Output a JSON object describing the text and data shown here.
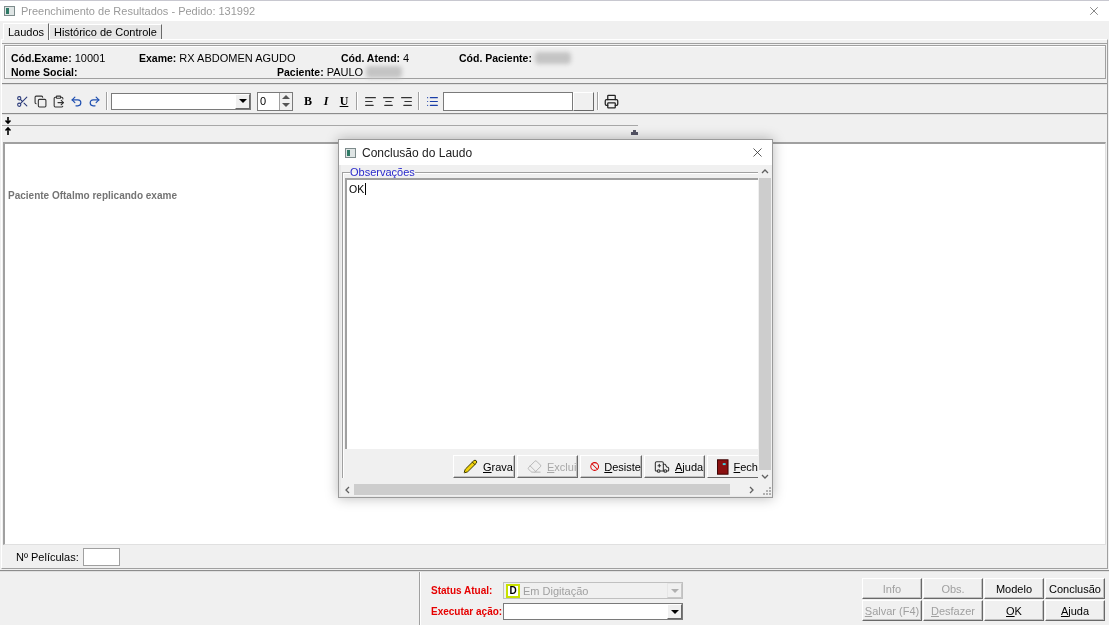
{
  "window": {
    "title": "Preenchimento de Resultados - Pedido: 131992"
  },
  "tabs": [
    {
      "label": "Laudos",
      "selected": true
    },
    {
      "label": "Histórico de Controle",
      "selected": false
    }
  ],
  "header": {
    "rows": [
      [
        {
          "label": "Cód.Exame:",
          "value": "10001"
        },
        {
          "label": "Exame:",
          "value": "RX ABDOMEN AGUDO"
        },
        {
          "label": "Cód. Atend:",
          "value": "4"
        },
        {
          "label": "Cód. Paciente:",
          "redacted": true
        }
      ],
      [
        {
          "label": "Nome Social:"
        },
        {
          "label": "Paciente:",
          "value": "PAULO",
          "redacted": true
        }
      ]
    ]
  },
  "toolbar": {
    "font_size": "0",
    "format_buttons": [
      {
        "kind": "bold",
        "label": "B"
      },
      {
        "kind": "italic",
        "label": "I"
      },
      {
        "kind": "underline",
        "label": "U"
      }
    ]
  },
  "editor": {
    "text": "Paciente Oftalmo replicando exame"
  },
  "films": {
    "label": "Nº Películas:"
  },
  "status": {
    "label": "Status Atual:",
    "badge": "D",
    "value": "Em Digitação",
    "disabled": true
  },
  "action": {
    "label": "Executar ação:",
    "disabled": false
  },
  "buttons": [
    {
      "label": "Info",
      "disabled": true,
      "mnemonic": false
    },
    {
      "label": "Obs.",
      "disabled": true,
      "mnemonic": false
    },
    {
      "label": "Modelo",
      "disabled": false,
      "mnemonic": false
    },
    {
      "label": "Conclusão",
      "disabled": false,
      "mnemonic": false
    },
    {
      "label": "Salvar (F4)",
      "disabled": true,
      "mnemonic": true
    },
    {
      "label": "Desfazer",
      "disabled": true,
      "mnemonic": true
    },
    {
      "label": "OK",
      "disabled": false,
      "mnemonic": true
    },
    {
      "label": "Ajuda",
      "disabled": false,
      "mnemonic": true
    }
  ],
  "dialog": {
    "title": "Conclusão do Laudo",
    "group_label": "Observações",
    "text": "OK",
    "focused": true,
    "buttons": [
      {
        "label": "Grava",
        "disabled": false,
        "mnemonic": true
      },
      {
        "label": "Exclui",
        "disabled": true,
        "mnemonic": true
      },
      {
        "label": "Desiste",
        "disabled": false,
        "mnemonic": true
      },
      {
        "label": "Ajuda",
        "disabled": false,
        "mnemonic": true
      },
      {
        "label": "Fech",
        "disabled": false,
        "mnemonic": true
      }
    ]
  }
}
